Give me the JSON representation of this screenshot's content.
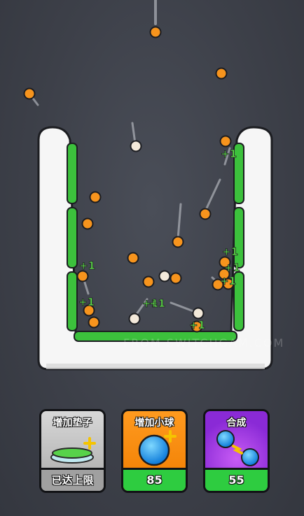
{
  "playfield": {
    "wall_color": "#f4f4f4",
    "pad_color": "#3cc13c",
    "ball_color": "#f7941d",
    "bonus_ball_color": "#f3e9da",
    "plus_text_color": "#5fe04a",
    "plus_labels": [
      "+1",
      "+1",
      "+1",
      "+1",
      "+1",
      "+1",
      "+1",
      "+1",
      "+1"
    ]
  },
  "watermark": "FROM SWITCHGAM.COM",
  "upgrades": [
    {
      "title": "增加垫子",
      "footer": "已达上限",
      "icon": "cushion-plus-icon"
    },
    {
      "title": "增加小球",
      "footer": "85",
      "icon": "blue-ball-plus-icon"
    },
    {
      "title": "合成",
      "footer": "55",
      "icon": "merge-balls-icon"
    }
  ]
}
